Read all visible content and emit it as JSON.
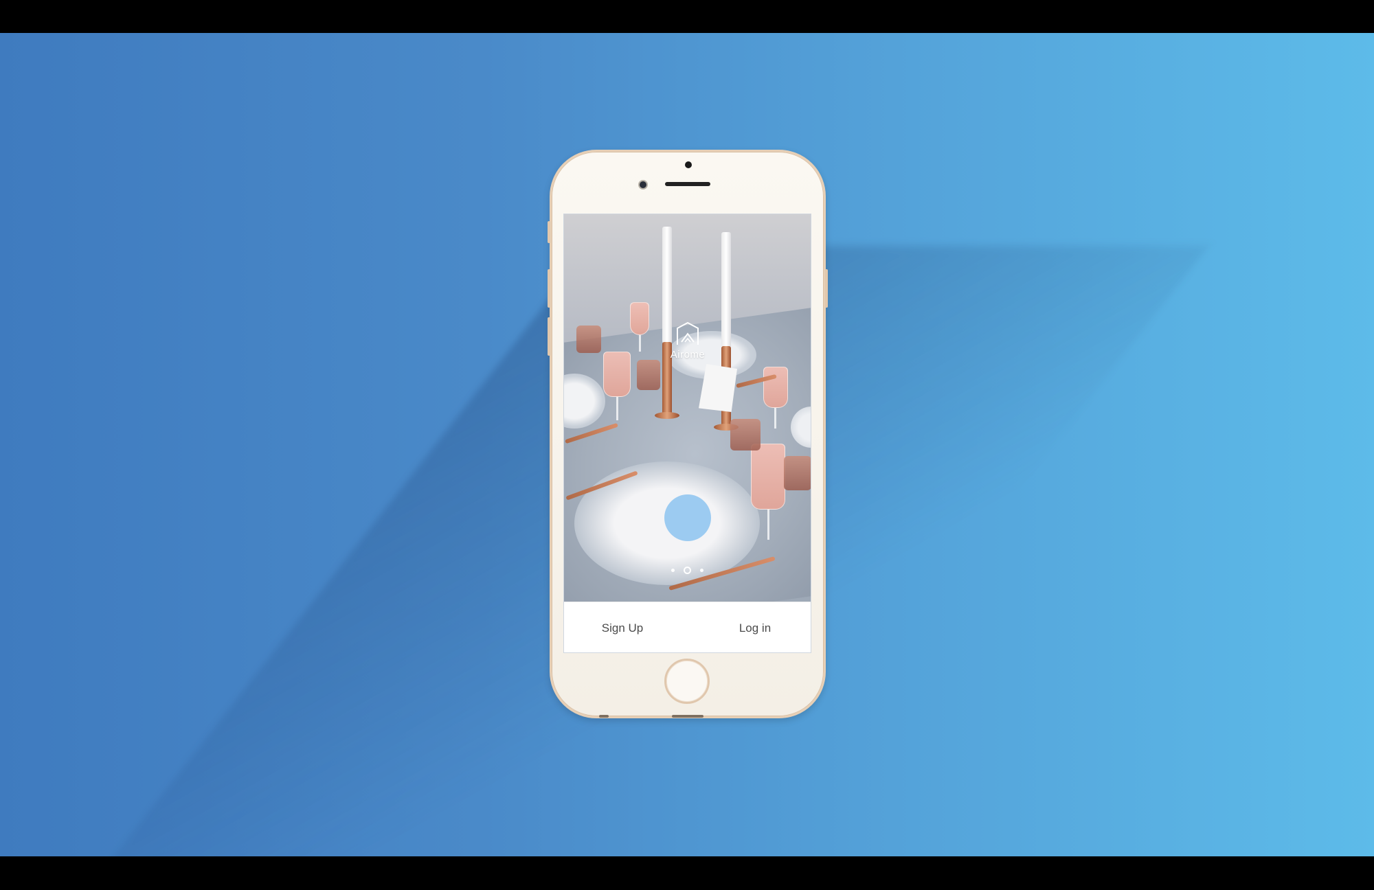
{
  "app": {
    "brand_name": "Airome",
    "logo_icon": "house-outline-icon"
  },
  "carousel": {
    "total_pages": 3,
    "active_page": 2
  },
  "actions": {
    "signup_label": "Sign Up",
    "login_label": "Log in"
  },
  "colors": {
    "background_left": "#3f7bbf",
    "background_right": "#5dbbe9",
    "phone_body": "#f6f1e8",
    "phone_trim": "#e6cfb6",
    "touch_indicator": "#8cc3f0",
    "button_text": "#4a4a4a"
  }
}
